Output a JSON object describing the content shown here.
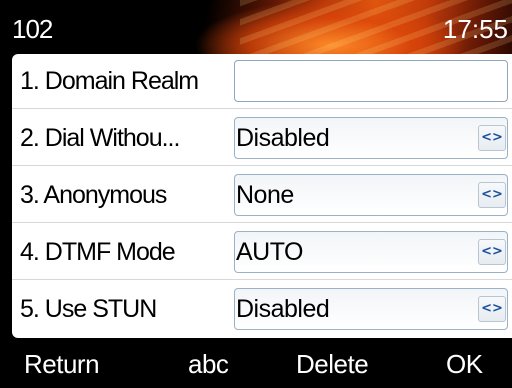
{
  "status": {
    "extension": "102",
    "time": "17:55"
  },
  "settings": [
    {
      "label": "1. Domain Realm",
      "value": "",
      "has_switch": false
    },
    {
      "label": "2. Dial Withou...",
      "value": "Disabled",
      "has_switch": true
    },
    {
      "label": "3. Anonymous",
      "value": "None",
      "has_switch": true
    },
    {
      "label": "4. DTMF Mode",
      "value": "AUTO",
      "has_switch": true
    },
    {
      "label": "5. Use STUN",
      "value": "Disabled",
      "has_switch": true
    }
  ],
  "switch_icon": "left-right-arrows-icon",
  "switch_glyph": "<>",
  "softkeys": {
    "return": "Return",
    "abc": "abc",
    "delete": "Delete",
    "ok": "OK"
  },
  "colors": {
    "accent_orange": "#e0560e",
    "field_border": "#9bb2c6",
    "arrow_blue": "#1d4f9a"
  }
}
